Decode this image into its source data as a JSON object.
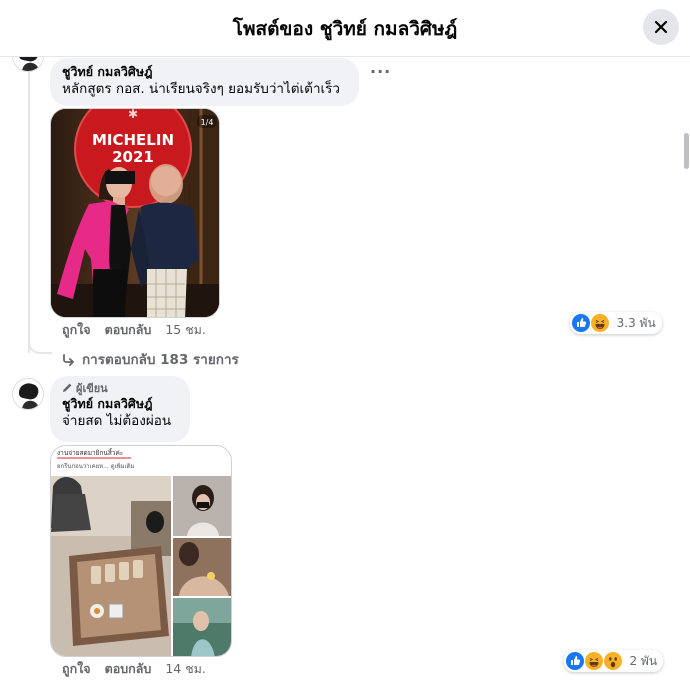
{
  "header": {
    "title": "โพสต์ของ ชูวิทย์ กมลวิศิษฎ์"
  },
  "comments": [
    {
      "author": "ชูวิทย์ กมลวิศิษฎ์",
      "text": "หลักสูตร กอส. น่าเรียนจริงๆ ยอมรับว่าไต่เต้าเร็ว",
      "photo": {
        "sign_text": "MICHELIN",
        "sign_year": "2021",
        "counter": "1/4"
      },
      "actions": {
        "like": "ถูกใจ",
        "reply": "ตอบกลับ",
        "time": "15 ชม."
      },
      "reactions": {
        "icons": [
          "like-icon",
          "haha-icon"
        ],
        "count": "3.3 พัน"
      },
      "replies_link": "การตอบกลับ 183 รายการ"
    },
    {
      "badge": "ผู้เขียน",
      "author": "ชูวิทย์ กมลวิศิษฎ์",
      "text": "จ่ายสด ไม่ต้องผ่อน",
      "photo": {
        "top_line_1": "งานจ่ายสดมายิกนสิ้วค่ะ",
        "top_line_2": "ยกรีนก่อนว่าเคยห... ดูเพิ่มเติม"
      },
      "actions": {
        "like": "ถูกใจ",
        "reply": "ตอบกลับ",
        "time": "14 ชม."
      },
      "reactions": {
        "icons": [
          "like-icon",
          "haha-icon",
          "wow-icon"
        ],
        "count": "2 พัน"
      }
    }
  ],
  "colors": {
    "bubble": "#f0f2f5",
    "secondary_text": "#65676b",
    "like_blue": "#1877f2",
    "haha_yellow": "#f7b125"
  }
}
